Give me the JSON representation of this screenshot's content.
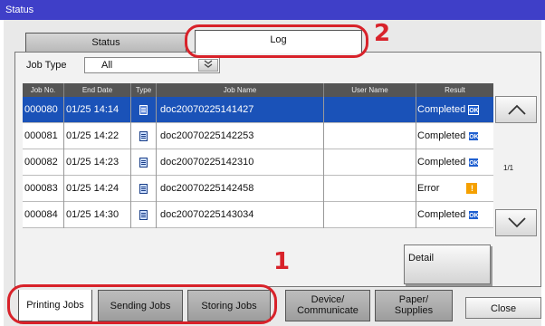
{
  "window": {
    "title": "Status"
  },
  "top_tabs": [
    {
      "label": "Status"
    },
    {
      "label": "Log"
    }
  ],
  "filter": {
    "label": "Job Type",
    "value": "All"
  },
  "table": {
    "headers": [
      "Job No.",
      "End Date",
      "Type",
      "Job Name",
      "User Name",
      "Result"
    ],
    "rows": [
      {
        "job_no": "000080",
        "end_date": "01/25 14:14",
        "job_name": "doc20070225141427",
        "user_name": "",
        "result": "Completed",
        "badge": "OK",
        "selected": true
      },
      {
        "job_no": "000081",
        "end_date": "01/25 14:22",
        "job_name": "doc20070225142253",
        "user_name": "",
        "result": "Completed",
        "badge": "OK",
        "selected": false
      },
      {
        "job_no": "000082",
        "end_date": "01/25 14:23",
        "job_name": "doc20070225142310",
        "user_name": "",
        "result": "Completed",
        "badge": "OK",
        "selected": false
      },
      {
        "job_no": "000083",
        "end_date": "01/25 14:24",
        "job_name": "doc20070225142458",
        "user_name": "",
        "result": "Error",
        "badge": "!",
        "selected": false
      },
      {
        "job_no": "000084",
        "end_date": "01/25 14:30",
        "job_name": "doc20070225143034",
        "user_name": "",
        "result": "Completed",
        "badge": "OK",
        "selected": false
      }
    ]
  },
  "pagination": {
    "indicator": "1/1"
  },
  "detail_button": {
    "label": "Detail"
  },
  "callouts": {
    "one": "1",
    "two": "2"
  },
  "bottom_tabs": {
    "printing": "Printing Jobs",
    "sending": "Sending Jobs",
    "storing": "Storing Jobs",
    "device_line1": "Device/",
    "device_line2": "Communicate",
    "paper_line1": "Paper/",
    "paper_line2": "Supplies",
    "close": "Close"
  },
  "icons": {
    "dropdown": "double-chevron-down-icon",
    "scroll_up": "chevron-up-icon",
    "scroll_down": "chevron-down-icon",
    "job_type": "print-document-icon",
    "ok": "ok-badge-icon",
    "error": "warning-icon"
  },
  "colors": {
    "title_bar": "#3f3fc8",
    "selected_row": "#1a52b8",
    "ok_badge": "#1f5fd0",
    "warning": "#f5a000",
    "callout": "#d8222a"
  }
}
